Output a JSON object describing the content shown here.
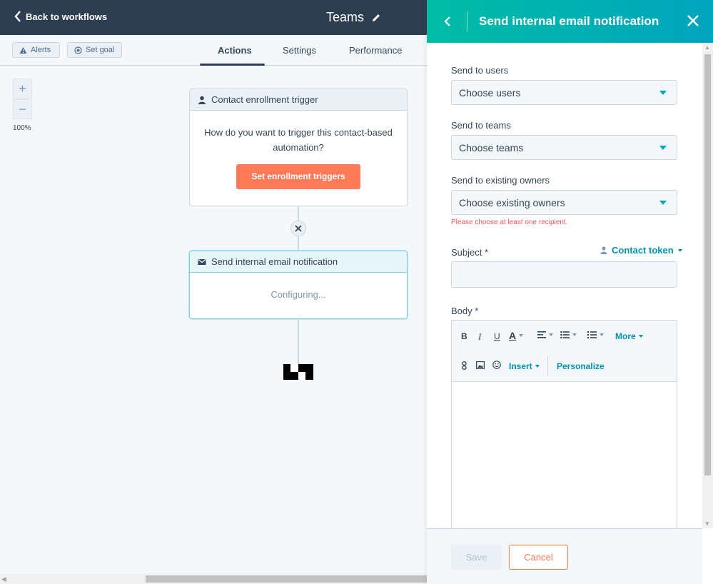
{
  "colors": {
    "topbar": "#2d3e50",
    "accent_teal": "#00a4bd",
    "accent_orange": "#ff7a59",
    "error": "#f2545b"
  },
  "header": {
    "back_label": "Back to workflows",
    "title": "Teams"
  },
  "subbar": {
    "alerts_label": "Alerts",
    "goal_label": "Set goal",
    "tabs": [
      {
        "label": "Actions",
        "active": true
      },
      {
        "label": "Settings",
        "active": false
      },
      {
        "label": "Performance",
        "active": false
      }
    ]
  },
  "canvas": {
    "zoom_in": "+",
    "zoom_out": "−",
    "zoom_level": "100%",
    "trigger_card": {
      "title": "Contact enrollment trigger",
      "prompt": "How do you want to trigger this contact-based automation?",
      "button": "Set enrollment triggers"
    },
    "action_card": {
      "title": "Send internal email notification",
      "status": "Configuring..."
    }
  },
  "panel": {
    "title": "Send internal email notification",
    "send_users": {
      "label": "Send to users",
      "value": "Choose users"
    },
    "send_teams": {
      "label": "Send to teams",
      "value": "Choose teams"
    },
    "send_owners": {
      "label": "Send to existing owners",
      "value": "Choose existing owners"
    },
    "error": "Please choose at least one recipient.",
    "subject_label": "Subject *",
    "contact_token": "Contact token",
    "body_label": "Body *",
    "toolbar": {
      "bold": "B",
      "italic": "I",
      "underline": "U",
      "text_color": "A",
      "more": "More",
      "insert": "Insert",
      "personalize": "Personalize"
    },
    "save": "Save",
    "cancel": "Cancel"
  }
}
